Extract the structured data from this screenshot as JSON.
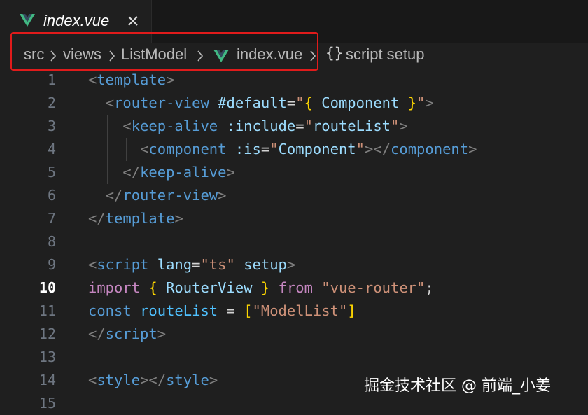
{
  "tab": {
    "label": "index.vue"
  },
  "breadcrumb": {
    "items": [
      "src",
      "views",
      "ListModel",
      "index.vue",
      "script setup"
    ]
  },
  "colors": {
    "vue_icon": "#41b883",
    "highlight": "#e01b1b",
    "editor_bg": "#1f1f1f"
  },
  "icons": [
    "vue-icon",
    "close-icon",
    "chevron-right-icon",
    "braces-icon"
  ],
  "editor": {
    "active_line": 10,
    "lines": [
      {
        "num": "1",
        "tokens": [
          [
            "tok-br",
            "<"
          ],
          [
            "tok-tag",
            "template"
          ],
          [
            "tok-br",
            ">"
          ]
        ]
      },
      {
        "num": "2",
        "tokens": [
          [
            "tok-plain",
            "  "
          ],
          [
            "tok-br",
            "<"
          ],
          [
            "tok-tag",
            "router-view"
          ],
          [
            "tok-plain",
            " "
          ],
          [
            "tok-attr",
            "#default"
          ],
          [
            "tok-plain",
            "="
          ],
          [
            "tok-str",
            "\""
          ],
          [
            "tok-brace",
            "{"
          ],
          [
            "tok-plain",
            " "
          ],
          [
            "tok-attr",
            "Component"
          ],
          [
            "tok-plain",
            " "
          ],
          [
            "tok-brace",
            "}"
          ],
          [
            "tok-str",
            "\""
          ],
          [
            "tok-br",
            ">"
          ]
        ]
      },
      {
        "num": "3",
        "tokens": [
          [
            "tok-plain",
            "    "
          ],
          [
            "tok-br",
            "<"
          ],
          [
            "tok-tag",
            "keep-alive"
          ],
          [
            "tok-plain",
            " "
          ],
          [
            "tok-attr",
            ":include"
          ],
          [
            "tok-plain",
            "="
          ],
          [
            "tok-str",
            "\""
          ],
          [
            "tok-attr",
            "routeList"
          ],
          [
            "tok-str",
            "\""
          ],
          [
            "tok-br",
            ">"
          ]
        ]
      },
      {
        "num": "4",
        "tokens": [
          [
            "tok-plain",
            "      "
          ],
          [
            "tok-br",
            "<"
          ],
          [
            "tok-tag",
            "component"
          ],
          [
            "tok-plain",
            " "
          ],
          [
            "tok-attr",
            ":is"
          ],
          [
            "tok-plain",
            "="
          ],
          [
            "tok-str",
            "\""
          ],
          [
            "tok-attr",
            "Component"
          ],
          [
            "tok-str",
            "\""
          ],
          [
            "tok-br",
            "></"
          ],
          [
            "tok-tag",
            "component"
          ],
          [
            "tok-br",
            ">"
          ]
        ]
      },
      {
        "num": "5",
        "tokens": [
          [
            "tok-plain",
            "    "
          ],
          [
            "tok-br",
            "</"
          ],
          [
            "tok-tag",
            "keep-alive"
          ],
          [
            "tok-br",
            ">"
          ]
        ]
      },
      {
        "num": "6",
        "tokens": [
          [
            "tok-plain",
            "  "
          ],
          [
            "tok-br",
            "</"
          ],
          [
            "tok-tag",
            "router-view"
          ],
          [
            "tok-br",
            ">"
          ]
        ]
      },
      {
        "num": "7",
        "tokens": [
          [
            "tok-br",
            "</"
          ],
          [
            "tok-tag",
            "template"
          ],
          [
            "tok-br",
            ">"
          ]
        ]
      },
      {
        "num": "8",
        "tokens": []
      },
      {
        "num": "9",
        "tokens": [
          [
            "tok-br",
            "<"
          ],
          [
            "tok-tag",
            "script"
          ],
          [
            "tok-plain",
            " "
          ],
          [
            "tok-attr",
            "lang"
          ],
          [
            "tok-plain",
            "="
          ],
          [
            "tok-str",
            "\"ts\""
          ],
          [
            "tok-plain",
            " "
          ],
          [
            "tok-attr",
            "setup"
          ],
          [
            "tok-br",
            ">"
          ]
        ]
      },
      {
        "num": "10",
        "tokens": [
          [
            "tok-kw",
            "import"
          ],
          [
            "tok-plain",
            " "
          ],
          [
            "tok-brace",
            "{"
          ],
          [
            "tok-plain",
            " "
          ],
          [
            "tok-attr",
            "RouterView"
          ],
          [
            "tok-plain",
            " "
          ],
          [
            "tok-brace",
            "}"
          ],
          [
            "tok-plain",
            " "
          ],
          [
            "tok-kw",
            "from"
          ],
          [
            "tok-plain",
            " "
          ],
          [
            "tok-str",
            "\"vue-router\""
          ],
          [
            "tok-plain",
            ";"
          ]
        ]
      },
      {
        "num": "11",
        "tokens": [
          [
            "tok-decl",
            "const"
          ],
          [
            "tok-plain",
            " "
          ],
          [
            "tok-var",
            "routeList"
          ],
          [
            "tok-plain",
            " = "
          ],
          [
            "tok-brace",
            "["
          ],
          [
            "tok-str",
            "\"ModelList\""
          ],
          [
            "tok-brace",
            "]"
          ]
        ]
      },
      {
        "num": "12",
        "tokens": [
          [
            "tok-br",
            "</"
          ],
          [
            "tok-tag",
            "script"
          ],
          [
            "tok-br",
            ">"
          ]
        ]
      },
      {
        "num": "13",
        "tokens": []
      },
      {
        "num": "14",
        "tokens": [
          [
            "tok-br",
            "<"
          ],
          [
            "tok-tag",
            "style"
          ],
          [
            "tok-br",
            "></"
          ],
          [
            "tok-tag",
            "style"
          ],
          [
            "tok-br",
            ">"
          ]
        ]
      },
      {
        "num": "15",
        "tokens": []
      }
    ]
  },
  "watermark": "掘金技术社区 @ 前端_小姜"
}
